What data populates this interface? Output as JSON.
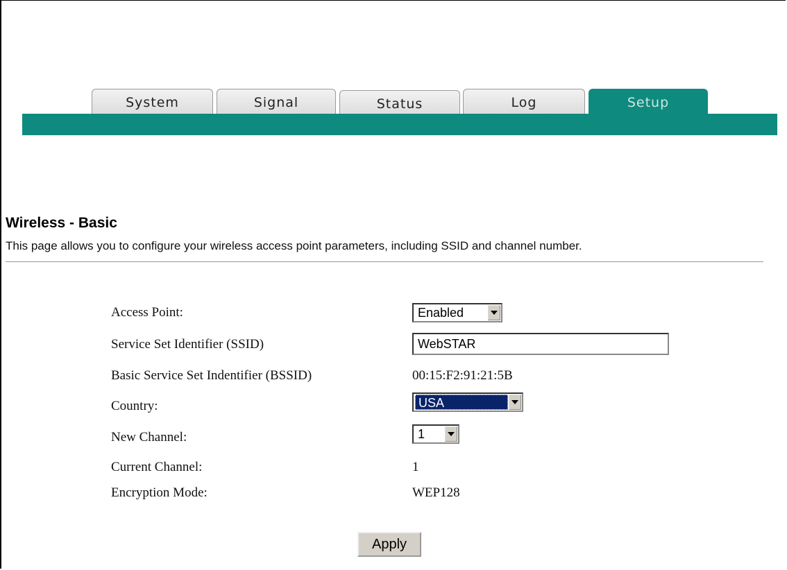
{
  "tabs": [
    {
      "label": "System"
    },
    {
      "label": "Signal"
    },
    {
      "label": "Status"
    },
    {
      "label": "Log"
    },
    {
      "label": "Setup"
    }
  ],
  "active_tab": "Setup",
  "colors": {
    "accent": "#0f8a7e"
  },
  "page": {
    "title": "Wireless - Basic",
    "description": "This page allows you to configure your wireless access point parameters, including SSID and channel number."
  },
  "form": {
    "access_point": {
      "label": "Access Point:",
      "value": "Enabled"
    },
    "ssid": {
      "label": "Service Set Identifier (SSID)",
      "value": "WebSTAR"
    },
    "bssid": {
      "label": "Basic Service Set Indentifier (BSSID)",
      "value": "00:15:F2:91:21:5B"
    },
    "country": {
      "label": "Country:",
      "value": "USA"
    },
    "new_channel": {
      "label": "New Channel:",
      "value": "1"
    },
    "current_channel": {
      "label": "Current Channel:",
      "value": "1"
    },
    "encryption_mode": {
      "label": "Encryption Mode:",
      "value": "WEP128"
    }
  },
  "apply_label": "Apply"
}
